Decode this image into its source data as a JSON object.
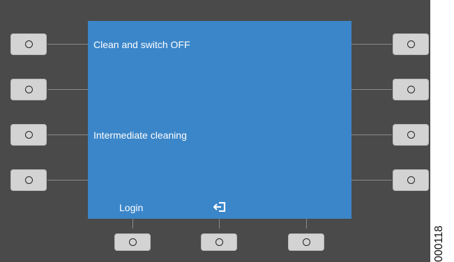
{
  "screen": {
    "labels": {
      "left1": "Clean and switch OFF",
      "left3": "Intermediate cleaning",
      "bottom1": "Login"
    },
    "bottom2_icon": "exit-arrow-icon"
  },
  "softkeys": {
    "left": [
      "softkey-left-1",
      "softkey-left-2",
      "softkey-left-3",
      "softkey-left-4"
    ],
    "right": [
      "softkey-right-1",
      "softkey-right-2",
      "softkey-right-3",
      "softkey-right-4"
    ],
    "bottom": [
      "softkey-bottom-1",
      "softkey-bottom-2",
      "softkey-bottom-3"
    ]
  },
  "figure_code": "000118",
  "colors": {
    "panel": "#4a4a4a",
    "screen": "#3b86c9",
    "key": "#d3d3d3",
    "text": "#ffffff"
  }
}
